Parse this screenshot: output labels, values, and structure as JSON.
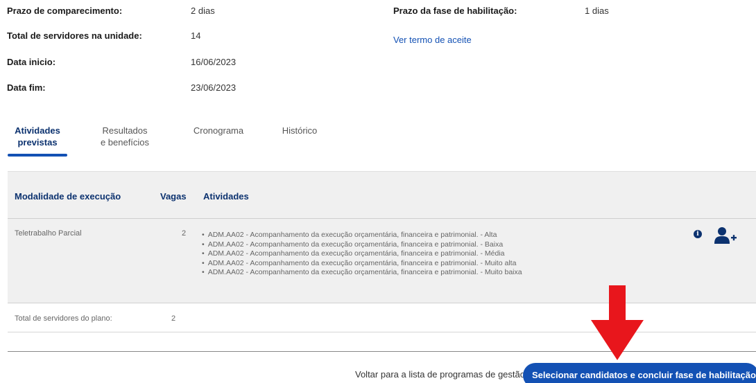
{
  "info": {
    "prazo_comparecimento": {
      "label": "Prazo de comparecimento:",
      "value": "2 dias"
    },
    "total_servidores_unidade": {
      "label": "Total de servidores na unidade:",
      "value": "14"
    },
    "data_inicio": {
      "label": "Data inicio:",
      "value": "16/06/2023"
    },
    "data_fim": {
      "label": "Data fim:",
      "value": "23/06/2023"
    },
    "prazo_fase_habilitacao": {
      "label": "Prazo da fase de habilitação:",
      "value": "1 dias"
    },
    "termo_aceite_link": "Ver termo de aceite"
  },
  "tabs": [
    {
      "line1": "Atividades",
      "line2": "previstas",
      "active": true
    },
    {
      "line1": "Resultados",
      "line2": "e benefícios",
      "active": false
    },
    {
      "line1": "Cronograma",
      "line2": "",
      "active": false
    },
    {
      "line1": "Histórico",
      "line2": "",
      "active": false
    }
  ],
  "table": {
    "headers": {
      "modalidade": "Modalidade de execução",
      "vagas": "Vagas",
      "atividades": "Atividades"
    },
    "rows": [
      {
        "modalidade": "Teletrabalho Parcial",
        "vagas": "2",
        "atividades": [
          "ADM.AA02 - Acompanhamento da execução orçamentária, financeira e patrimonial. - Alta",
          "ADM.AA02 - Acompanhamento da execução orçamentária, financeira e patrimonial. - Baixa",
          "ADM.AA02 - Acompanhamento da execução orçamentária, financeira e patrimonial. - Média",
          "ADM.AA02 - Acompanhamento da execução orçamentária, financeira e patrimonial. - Muito alta",
          "ADM.AA02 - Acompanhamento da execução orçamentária, financeira e patrimonial. - Muito baixa"
        ],
        "info_icon_glyph": "i"
      }
    ],
    "total": {
      "label": "Total de servidores do plano:",
      "value": "2"
    }
  },
  "footer": {
    "back_link": "Voltar para a lista de programas de gestão",
    "primary_button": "Selecionar candidatos e concluir fase de habilitação"
  },
  "colors": {
    "primary": "#1351b4",
    "dark_blue": "#0c326f",
    "annotation_arrow": "#e8161c"
  },
  "icons": {
    "info": "info-circle-icon",
    "add_user": "user-plus-icon",
    "annotation": "arrow-down-icon"
  }
}
